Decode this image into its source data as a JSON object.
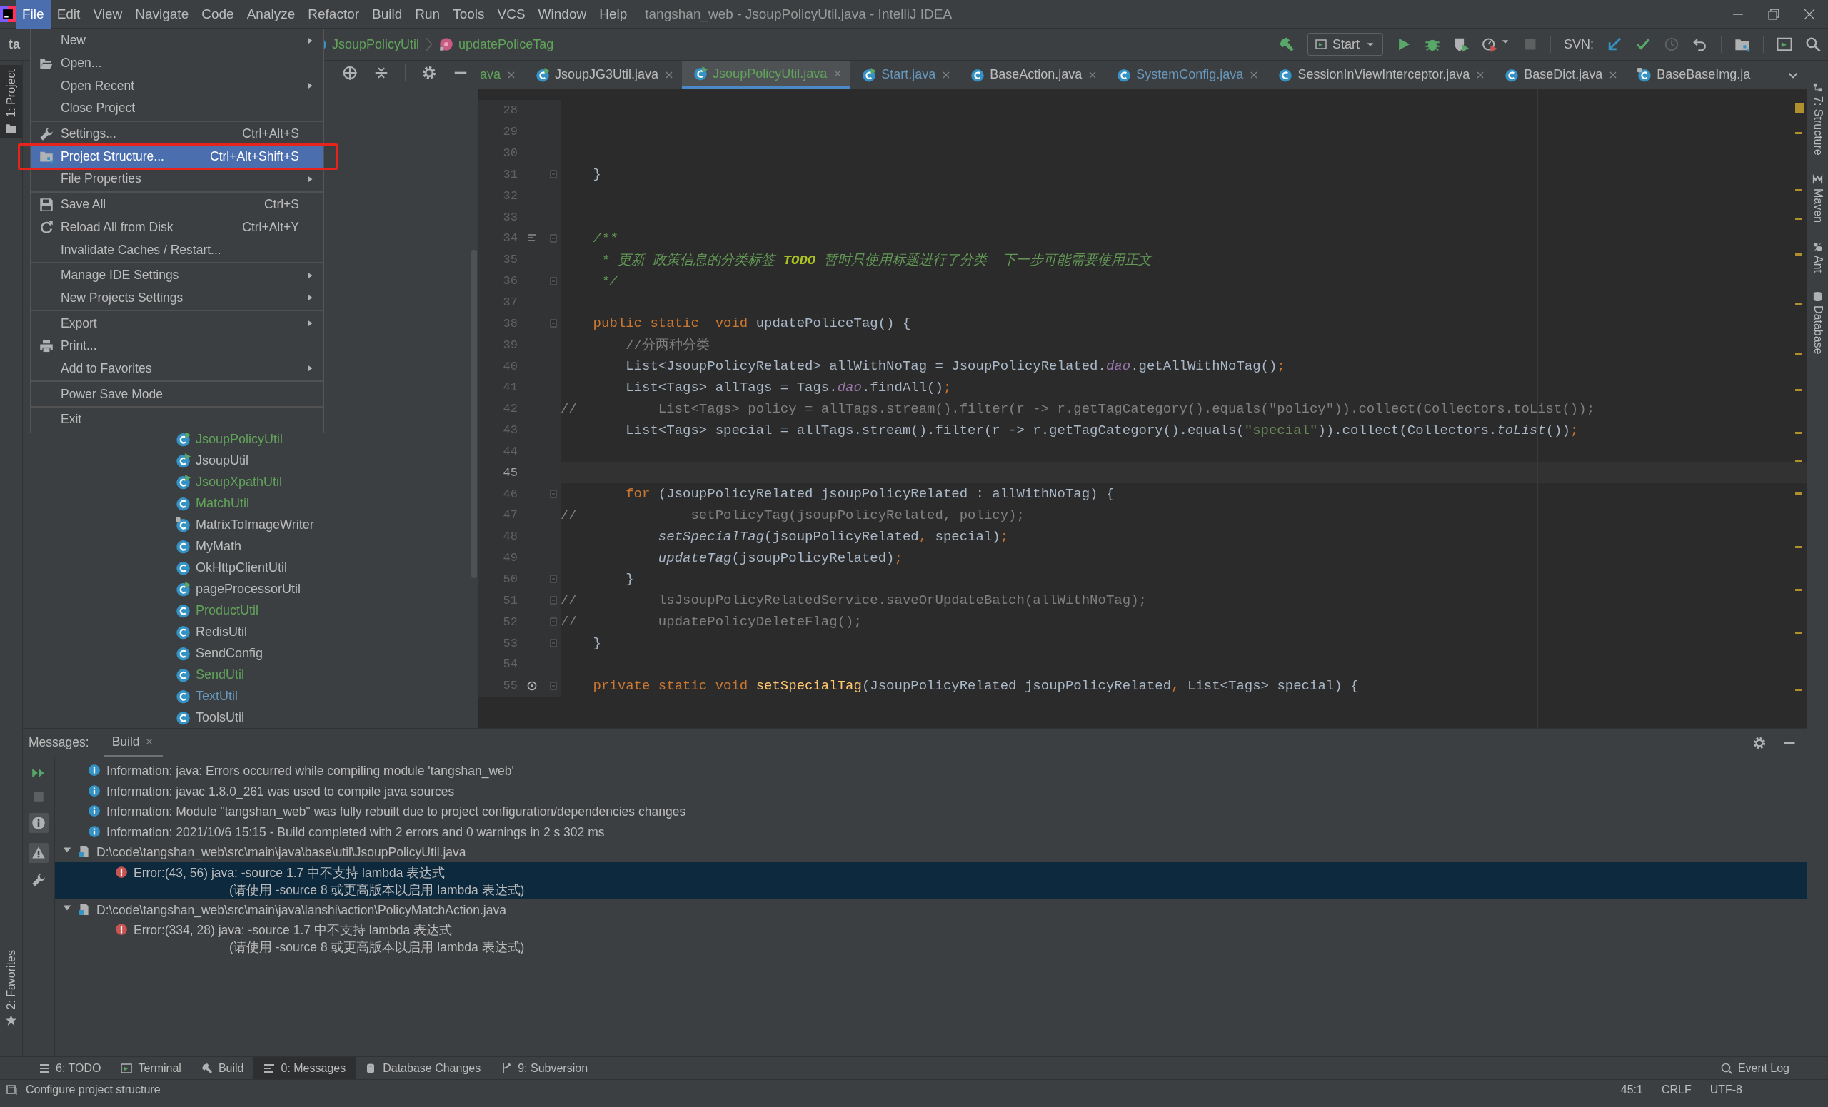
{
  "window": {
    "title": "tangshan_web - JsoupPolicyUtil.java - IntelliJ IDEA"
  },
  "menu_bar": [
    {
      "label": "File",
      "selected": true
    },
    {
      "label": "Edit",
      "selected": false
    },
    {
      "label": "View",
      "selected": false
    },
    {
      "label": "Navigate",
      "selected": false
    },
    {
      "label": "Code",
      "selected": false
    },
    {
      "label": "Analyze",
      "selected": false
    },
    {
      "label": "Refactor",
      "selected": false
    },
    {
      "label": "Build",
      "selected": false
    },
    {
      "label": "Run",
      "selected": false
    },
    {
      "label": "Tools",
      "selected": false
    },
    {
      "label": "VCS",
      "selected": false
    },
    {
      "label": "Window",
      "selected": false
    },
    {
      "label": "Help",
      "selected": false
    }
  ],
  "file_menu": {
    "groups": [
      [
        {
          "label": "New",
          "submenu": true,
          "selected": false,
          "highlighted": false
        },
        {
          "label": "Open...",
          "kind": "open",
          "submenu": false,
          "selected": false,
          "highlighted": false
        },
        {
          "label": "Open Recent",
          "submenu": true,
          "selected": false,
          "highlighted": false
        },
        {
          "label": "Close Project",
          "submenu": false,
          "selected": false,
          "highlighted": false
        }
      ],
      [
        {
          "label": "Settings...",
          "kind": "settings",
          "shortcut": "Ctrl+Alt+S",
          "submenu": false,
          "selected": false,
          "highlighted": false
        },
        {
          "label": "Project Structure...",
          "kind": "structure",
          "shortcut": "Ctrl+Alt+Shift+S",
          "submenu": false,
          "selected": true,
          "highlighted": true
        },
        {
          "label": "File Properties",
          "submenu": true,
          "selected": false,
          "highlighted": false
        }
      ],
      [
        {
          "label": "Save All",
          "kind": "save",
          "shortcut": "Ctrl+S",
          "submenu": false,
          "selected": false,
          "highlighted": false
        },
        {
          "label": "Reload All from Disk",
          "kind": "reload",
          "shortcut": "Ctrl+Alt+Y",
          "submenu": false,
          "selected": false,
          "highlighted": false
        },
        {
          "label": "Invalidate Caches / Restart...",
          "submenu": false,
          "selected": false,
          "highlighted": false
        }
      ],
      [
        {
          "label": "Manage IDE Settings",
          "submenu": true,
          "selected": false,
          "highlighted": false
        },
        {
          "label": "New Projects Settings",
          "submenu": true,
          "selected": false,
          "highlighted": false
        }
      ],
      [
        {
          "label": "Export",
          "submenu": true,
          "selected": false,
          "highlighted": false
        },
        {
          "label": "Print...",
          "kind": "print",
          "submenu": false,
          "selected": false,
          "highlighted": false
        },
        {
          "label": "Add to Favorites",
          "submenu": true,
          "selected": false,
          "highlighted": false
        }
      ],
      [
        {
          "label": "Power Save Mode",
          "submenu": false,
          "selected": false,
          "highlighted": false
        }
      ],
      [
        {
          "label": "Exit",
          "submenu": false,
          "selected": false,
          "highlighted": false
        }
      ]
    ]
  },
  "navigation_bar": {
    "project": "ta",
    "breadcrumbs": [
      {
        "label": "JsoupPolicyUtil",
        "kind": "class"
      },
      {
        "label": "updatePoliceTag",
        "kind": "method"
      }
    ]
  },
  "run_toolbar": {
    "configuration": "Start",
    "svn_label": "SVN:"
  },
  "left_stripe": {
    "top": [
      {
        "label": "1: Project",
        "kind": "project",
        "selected": true
      }
    ],
    "bottom": [
      {
        "label": "2: Favorites",
        "kind": "favorites",
        "selected": false
      }
    ]
  },
  "right_stripe": [
    {
      "label": "7: Structure",
      "kind": "structure"
    },
    {
      "label": "Maven",
      "kind": "maven"
    },
    {
      "label": "Ant",
      "kind": "ant"
    },
    {
      "label": "Database",
      "kind": "database"
    }
  ],
  "project_tree": [
    {
      "label": "JsoupPolicyUtil",
      "kind": "runnable",
      "color": "#62a35c"
    },
    {
      "label": "JsoupUtil",
      "kind": "runnable",
      "color": "#bbbbbb"
    },
    {
      "label": "JsoupXpathUtil",
      "kind": "runnable",
      "color": "#62a35c"
    },
    {
      "label": "MatchUtil",
      "kind": "class",
      "color": "#62a35c"
    },
    {
      "label": "MatrixToImageWriter",
      "kind": "locked",
      "color": "#bbbbbb"
    },
    {
      "label": "MyMath",
      "kind": "class",
      "color": "#bbbbbb"
    },
    {
      "label": "OkHttpClientUtil",
      "kind": "class",
      "color": "#bbbbbb"
    },
    {
      "label": "pageProcessorUtil",
      "kind": "runnable",
      "color": "#bbbbbb"
    },
    {
      "label": "ProductUtil",
      "kind": "class",
      "color": "#62a35c"
    },
    {
      "label": "RedisUtil",
      "kind": "class",
      "color": "#bbbbbb"
    },
    {
      "label": "SendConfig",
      "kind": "class",
      "color": "#bbbbbb"
    },
    {
      "label": "SendUtil",
      "kind": "class",
      "color": "#62a35c"
    },
    {
      "label": "TextUtil",
      "kind": "class",
      "color": "#6897bb"
    },
    {
      "label": "ToolsUtil",
      "kind": "class",
      "color": "#bbbbbb"
    }
  ],
  "editor": {
    "tabs": [
      {
        "label": "ava",
        "kind": "cut",
        "color": "#62a35c",
        "selected": false,
        "closable": true
      },
      {
        "label": "JsoupJG3Util.java",
        "kind": "runnable",
        "color": "#bbbbbb",
        "selected": false,
        "closable": true
      },
      {
        "label": "JsoupPolicyUtil.java",
        "kind": "runnable",
        "color": "#62a35c",
        "selected": true,
        "closable": true
      },
      {
        "label": "Start.java",
        "kind": "runnable",
        "color": "#6897bb",
        "selected": false,
        "closable": true
      },
      {
        "label": "BaseAction.java",
        "kind": "class",
        "color": "#bbbbbb",
        "selected": false,
        "closable": true
      },
      {
        "label": "SystemConfig.java",
        "kind": "class",
        "color": "#6897bb",
        "selected": false,
        "closable": true
      },
      {
        "label": "SessionInViewInterceptor.java",
        "kind": "class",
        "color": "#bbbbbb",
        "selected": false,
        "closable": true
      },
      {
        "label": "BaseDict.java",
        "kind": "class",
        "color": "#bbbbbb",
        "selected": false,
        "closable": true
      },
      {
        "label": "BaseBaseImg.ja",
        "kind": "locked",
        "color": "#bbbbbb",
        "selected": false,
        "closable": false
      }
    ],
    "lines": [
      {
        "number": "28",
        "current": false,
        "fold": false
      },
      {
        "number": "29",
        "current": false,
        "fold": false
      },
      {
        "number": "30",
        "current": false,
        "fold": false
      },
      {
        "number": "31",
        "current": false,
        "fold": true,
        "code": [
          {
            "text": "    }",
            "kind": "plain"
          }
        ]
      },
      {
        "number": "32",
        "current": false,
        "fold": false
      },
      {
        "number": "33",
        "current": false,
        "fold": false
      },
      {
        "number": "34",
        "current": false,
        "fold": true,
        "kind": "doc",
        "code": [
          {
            "text": "    /**",
            "kind": "doc"
          }
        ]
      },
      {
        "number": "35",
        "current": false,
        "fold": false,
        "code": [
          {
            "text": "     * 更新 政策信息的分类标签 ",
            "kind": "doc"
          },
          {
            "text": "TODO",
            "kind": "todo"
          },
          {
            "text": " 暂时只使用标题进行了分类  下一步可能需要使用正文",
            "kind": "doc"
          }
        ]
      },
      {
        "number": "36",
        "current": false,
        "fold": true,
        "code": [
          {
            "text": "     */",
            "kind": "doc"
          }
        ]
      },
      {
        "number": "37",
        "current": false,
        "fold": false
      },
      {
        "number": "38",
        "current": false,
        "fold": true,
        "code": [
          {
            "text": "    public static  void",
            "kind": "keyword"
          },
          {
            "text": " updatePoliceTag() {",
            "kind": "plain"
          }
        ]
      },
      {
        "number": "39",
        "current": false,
        "fold": false,
        "code": [
          {
            "text": "        //分两种分类",
            "kind": "comment"
          }
        ]
      },
      {
        "number": "40",
        "current": false,
        "fold": false,
        "code": [
          {
            "text": "        List<JsoupPolicyRelated> allWithNoTag = JsoupPolicyRelated.",
            "kind": "plain"
          },
          {
            "text": "dao",
            "kind": "field"
          },
          {
            "text": ".getAllWithNoTag()",
            "kind": "plain"
          },
          {
            "text": ";",
            "kind": "keyword"
          }
        ]
      },
      {
        "number": "41",
        "current": false,
        "fold": false,
        "code": [
          {
            "text": "        List<Tags> allTags = Tags.",
            "kind": "plain"
          },
          {
            "text": "dao",
            "kind": "field"
          },
          {
            "text": ".findAll()",
            "kind": "plain"
          },
          {
            "text": ";",
            "kind": "keyword"
          }
        ]
      },
      {
        "number": "42",
        "current": false,
        "fold": false,
        "code": [
          {
            "text": "//          List<Tags> policy = allTags.stream().filter(r -> r.getTagCategory().equals(\"policy\")).collect(Collectors.toList());",
            "kind": "comment"
          }
        ]
      },
      {
        "number": "43",
        "current": false,
        "fold": false,
        "code": [
          {
            "text": "        List<Tags> special = allTags.stream().filter(r -> r.getTagCategory().equals(",
            "kind": "plain"
          },
          {
            "text": "\"special\"",
            "kind": "string"
          },
          {
            "text": ")).collect(Collectors.",
            "kind": "plain"
          },
          {
            "text": "toList",
            "kind": "static"
          },
          {
            "text": "())",
            "kind": "plain"
          },
          {
            "text": ";",
            "kind": "keyword"
          }
        ]
      },
      {
        "number": "44",
        "current": false,
        "fold": false
      },
      {
        "number": "45",
        "current": true,
        "fold": false
      },
      {
        "number": "46",
        "current": false,
        "fold": true,
        "code": [
          {
            "text": "        for",
            "kind": "keyword"
          },
          {
            "text": " (JsoupPolicyRelated jsoupPolicyRelated : allWithNoTag) {",
            "kind": "plain"
          }
        ]
      },
      {
        "number": "47",
        "current": false,
        "fold": false,
        "code": [
          {
            "text": "//              setPolicyTag(jsoupPolicyRelated, policy);",
            "kind": "comment"
          }
        ]
      },
      {
        "number": "48",
        "current": false,
        "fold": false,
        "code": [
          {
            "text": "            setSpecialTag",
            "kind": "static"
          },
          {
            "text": "(jsoupPolicyRelated",
            "kind": "plain"
          },
          {
            "text": ",",
            "kind": "keyword"
          },
          {
            "text": " special)",
            "kind": "plain"
          },
          {
            "text": ";",
            "kind": "keyword"
          }
        ]
      },
      {
        "number": "49",
        "current": false,
        "fold": false,
        "code": [
          {
            "text": "            updateTag",
            "kind": "static"
          },
          {
            "text": "(jsoupPolicyRelated)",
            "kind": "plain"
          },
          {
            "text": ";",
            "kind": "keyword"
          }
        ]
      },
      {
        "number": "50",
        "current": false,
        "fold": true,
        "code": [
          {
            "text": "        }",
            "kind": "plain"
          }
        ]
      },
      {
        "number": "51",
        "current": false,
        "fold": true,
        "code": [
          {
            "text": "//          lsJsoupPolicyRelatedService.saveOrUpdateBatch(allWithNoTag);",
            "kind": "comment"
          }
        ]
      },
      {
        "number": "52",
        "current": false,
        "fold": true,
        "code": [
          {
            "text": "//          updatePolicyDeleteFlag();",
            "kind": "comment"
          }
        ]
      },
      {
        "number": "53",
        "current": false,
        "fold": true,
        "code": [
          {
            "text": "    }",
            "kind": "plain"
          }
        ]
      },
      {
        "number": "54",
        "current": false,
        "fold": false
      },
      {
        "number": "55",
        "current": false,
        "fold": true,
        "kind": "override",
        "code": [
          {
            "text": "    private static void ",
            "kind": "keyword"
          },
          {
            "text": "setSpecialTag",
            "kind": "method"
          },
          {
            "text": "(JsoupPolicyRelated jsoupPolicyRelated",
            "kind": "plain"
          },
          {
            "text": ",",
            "kind": "keyword"
          },
          {
            "text": " List<Tags> special) {",
            "kind": "plain"
          }
        ]
      }
    ]
  },
  "messages": {
    "title": "Messages:",
    "tabs": [
      {
        "label": "Build",
        "selected": true
      }
    ],
    "items": [
      {
        "kind": "info",
        "text": "Information: java: Errors occurred while compiling module 'tangshan_web'",
        "selected": false
      },
      {
        "kind": "info",
        "text": "Information: javac 1.8.0_261 was used to compile java sources",
        "selected": false
      },
      {
        "kind": "info",
        "text": "Information: Module \"tangshan_web\" was fully rebuilt due to project configuration/dependencies changes",
        "selected": false
      },
      {
        "kind": "info",
        "text": "Information: 2021/10/6 15:15 - Build completed with 2 errors and 0 warnings in 2 s 302 ms",
        "selected": false
      },
      {
        "kind": "file",
        "text": "D:\\code\\tangshan_web\\src\\main\\java\\base\\util\\JsoupPolicyUtil.java",
        "expanded": true,
        "selected": false,
        "children": [
          {
            "kind": "error",
            "text": "Error:(43, 56)  java: -source 1.7 中不支持 lambda 表达式",
            "detail": "(请使用 -source 8 或更高版本以启用 lambda 表达式)",
            "selected": true
          }
        ]
      },
      {
        "kind": "file",
        "text": "D:\\code\\tangshan_web\\src\\main\\java\\lanshi\\action\\PolicyMatchAction.java",
        "expanded": true,
        "selected": false,
        "children": [
          {
            "kind": "error",
            "text": "Error:(334, 28)  java: -source 1.7 中不支持 lambda 表达式",
            "detail": "(请使用 -source 8 或更高版本以启用 lambda 表达式)",
            "selected": false
          }
        ]
      }
    ]
  },
  "tool_windows": [
    {
      "label": "6: TODO",
      "kind": "todo",
      "selected": false
    },
    {
      "label": "Terminal",
      "kind": "terminal",
      "selected": false
    },
    {
      "label": "Build",
      "kind": "build",
      "selected": false
    },
    {
      "label": "0: Messages",
      "kind": "messages",
      "selected": true
    },
    {
      "label": "Database Changes",
      "kind": "database",
      "selected": false
    },
    {
      "label": "9: Subversion",
      "kind": "vcs",
      "selected": false
    }
  ],
  "event_log": "Event Log",
  "status_bar": {
    "message": "Configure project structure",
    "caret_position": "45:1",
    "line_separator": "CRLF",
    "encoding": "UTF-8"
  }
}
